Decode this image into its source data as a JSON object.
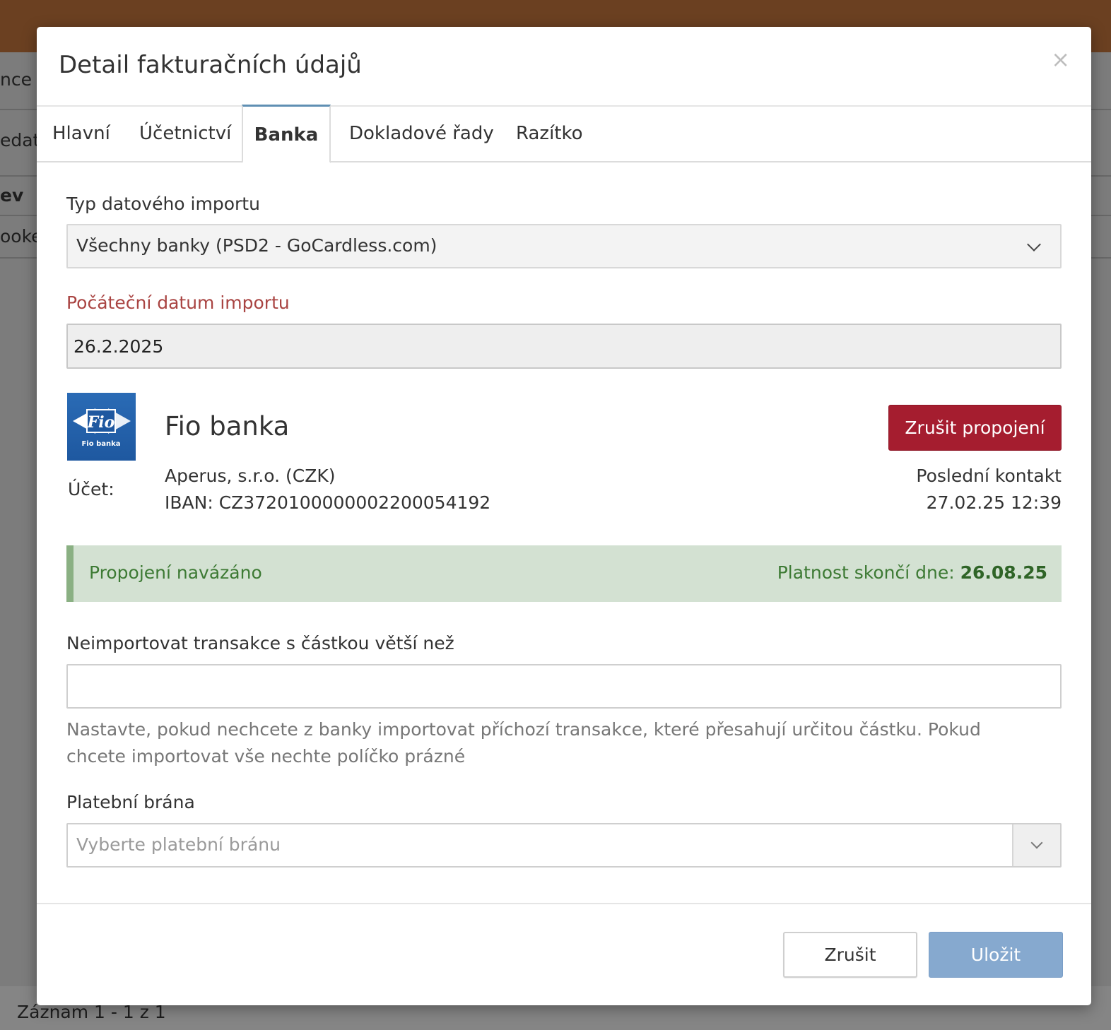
{
  "background": {
    "row_fragments": [
      "nce",
      "edat",
      "ev",
      "ooke"
    ],
    "footer_text": "Záznam 1 - 1 z 1"
  },
  "modal": {
    "title": "Detail fakturačních údajů",
    "close_glyph": "×"
  },
  "tabs": [
    {
      "label": "Hlavní",
      "active": false
    },
    {
      "label": "Účetnictví",
      "active": false
    },
    {
      "label": "Banka",
      "active": true
    },
    {
      "label": "Dokladové řady",
      "active": false
    },
    {
      "label": "Razítko",
      "active": false
    }
  ],
  "form": {
    "import_type": {
      "label": "Typ datového importu",
      "value": "Všechny banky (PSD2 - GoCardless.com)"
    },
    "start_date": {
      "label": "Počáteční datum importu",
      "value": "26.2.2025"
    },
    "bank": {
      "logo_text": "Fio",
      "logo_subtext": "Fio banka",
      "name": "Fio banka",
      "unlink_label": "Zrušit propojení",
      "account_label": "Účet:",
      "account_name": "Aperus, s.r.o. (CZK)",
      "iban": "IBAN: CZ3720100000002200054192",
      "last_contact_label": "Poslední kontakt",
      "last_contact_value": "27.02.25 12:39"
    },
    "status": {
      "message": "Propojení navázáno",
      "validity_label": "Platnost skončí dne:",
      "validity_date": "26.08.25"
    },
    "max_amount": {
      "label": "Neimportovat transakce s částkou větší než",
      "value": "",
      "help": "Nastavte, pokud nechcete z banky importovat příchozí transakce, které přesahují určitou částku. Pokud chcete importovat vše nechte políčko prázné"
    },
    "gateway": {
      "label": "Platební brána",
      "placeholder": "Vyberte platební bránu"
    }
  },
  "buttons": {
    "cancel": "Zrušit",
    "save": "Uložit"
  },
  "colors": {
    "topbar": "#6b4021",
    "tab_active_accent": "#5f8fb3",
    "error_label": "#a94442",
    "danger_button": "#a51d2f",
    "success_bg": "#d3e1d2",
    "success_text": "#3d7a34",
    "primary_button": "#86a9cf"
  }
}
